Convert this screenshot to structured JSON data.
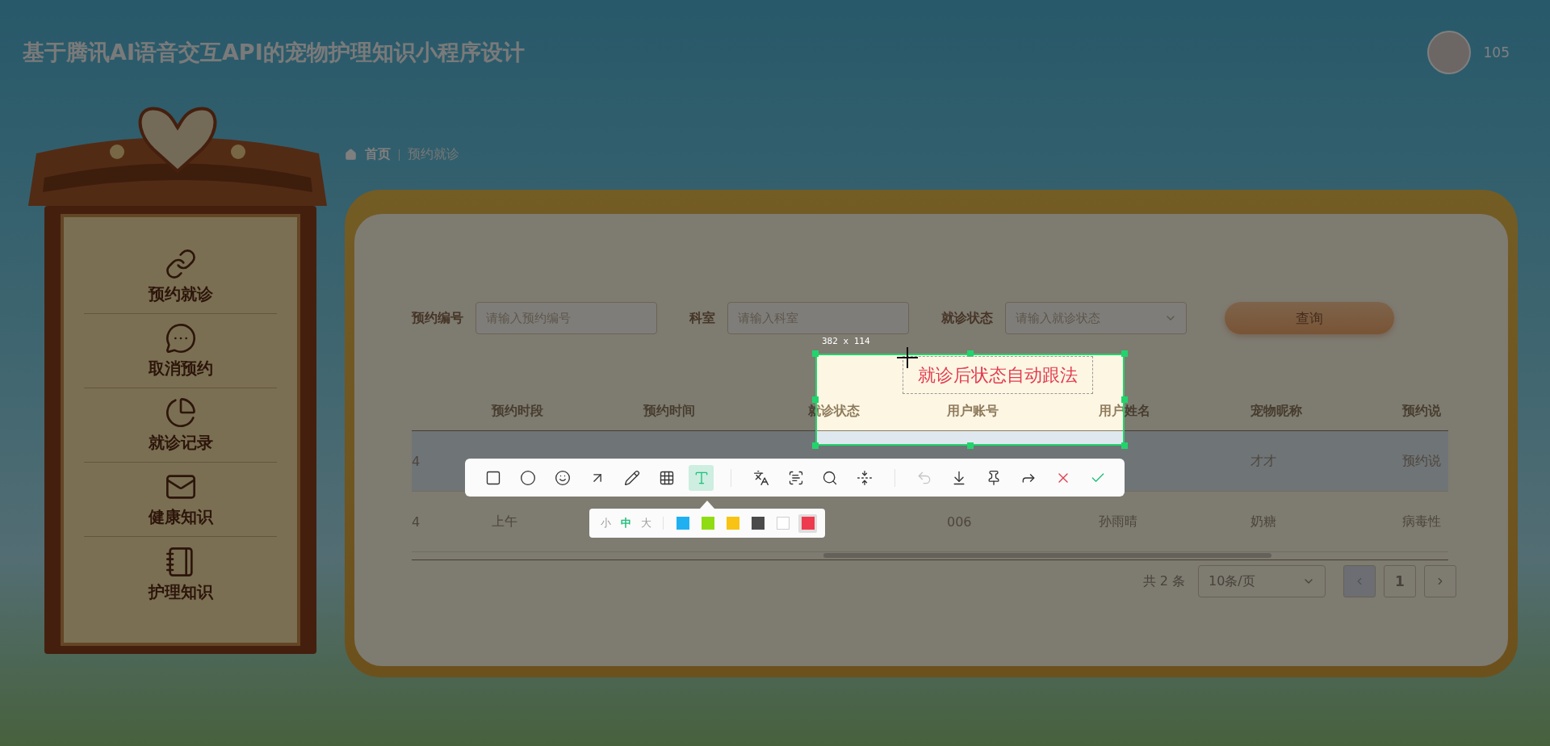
{
  "app_title": "基于腾讯AI语音交互API的宠物护理知识小程序设计",
  "user": {
    "name": "105"
  },
  "breadcrumb": [
    {
      "kind": "home",
      "label": "首页"
    },
    {
      "kind": "current",
      "label": "预约就诊"
    }
  ],
  "sidebar": {
    "items": [
      {
        "label": "预约就诊"
      },
      {
        "label": "取消预约"
      },
      {
        "label": "就诊记录"
      },
      {
        "label": "健康知识"
      },
      {
        "label": "护理知识"
      }
    ]
  },
  "filters": [
    {
      "kind": "input",
      "label": "预约编号",
      "placeholder": "请输入预约编号"
    },
    {
      "kind": "input",
      "label": "科室",
      "placeholder": "请输入科室"
    },
    {
      "kind": "select",
      "label": "就诊状态",
      "placeholder": "请输入就诊状态"
    }
  ],
  "search_button": "查询",
  "table": {
    "columns": [
      null,
      "预约时段",
      "预约时间",
      "就诊状态",
      "用户账号",
      "用户姓名",
      "宠物昵称",
      "预约说"
    ],
    "rows": [
      {
        "hovered": true,
        "cells": [
          "4",
          null,
          null,
          null,
          null,
          null,
          "才才",
          "预约说"
        ]
      },
      {
        "hovered": false,
        "cells": [
          "4",
          "上午",
          null,
          null,
          "006",
          "孙雨晴",
          "奶糖",
          "病毒性"
        ]
      }
    ]
  },
  "pagination": {
    "total": "共 2 条",
    "page_size": "10条/页",
    "prev": {
      "disabled": true
    },
    "next": {
      "disabled": false
    },
    "pages": [
      {
        "label": "1",
        "selected": true
      }
    ]
  },
  "capture": {
    "size_label": "382 x 114",
    "annotation": "就诊后状态自动跟法",
    "tools": [
      {
        "selected": false
      },
      {
        "selected": false
      },
      {
        "selected": false
      },
      {
        "selected": false
      },
      {
        "selected": false
      },
      {
        "selected": false
      },
      {
        "selected": true
      }
    ],
    "text_sizes": [
      {
        "label": "小",
        "selected": false
      },
      {
        "label": "中",
        "selected": true
      },
      {
        "label": "大",
        "selected": false
      }
    ],
    "colors": [
      {
        "color": "#1fb0f2",
        "selected": false
      },
      {
        "color": "#8fdc12",
        "selected": false
      },
      {
        "color": "#f8c313",
        "selected": false
      },
      {
        "color": "#4a4a4a",
        "selected": false
      },
      {
        "color": "#ffffff",
        "selected": false
      },
      {
        "color": "#ee3a4e",
        "selected": true
      }
    ]
  }
}
